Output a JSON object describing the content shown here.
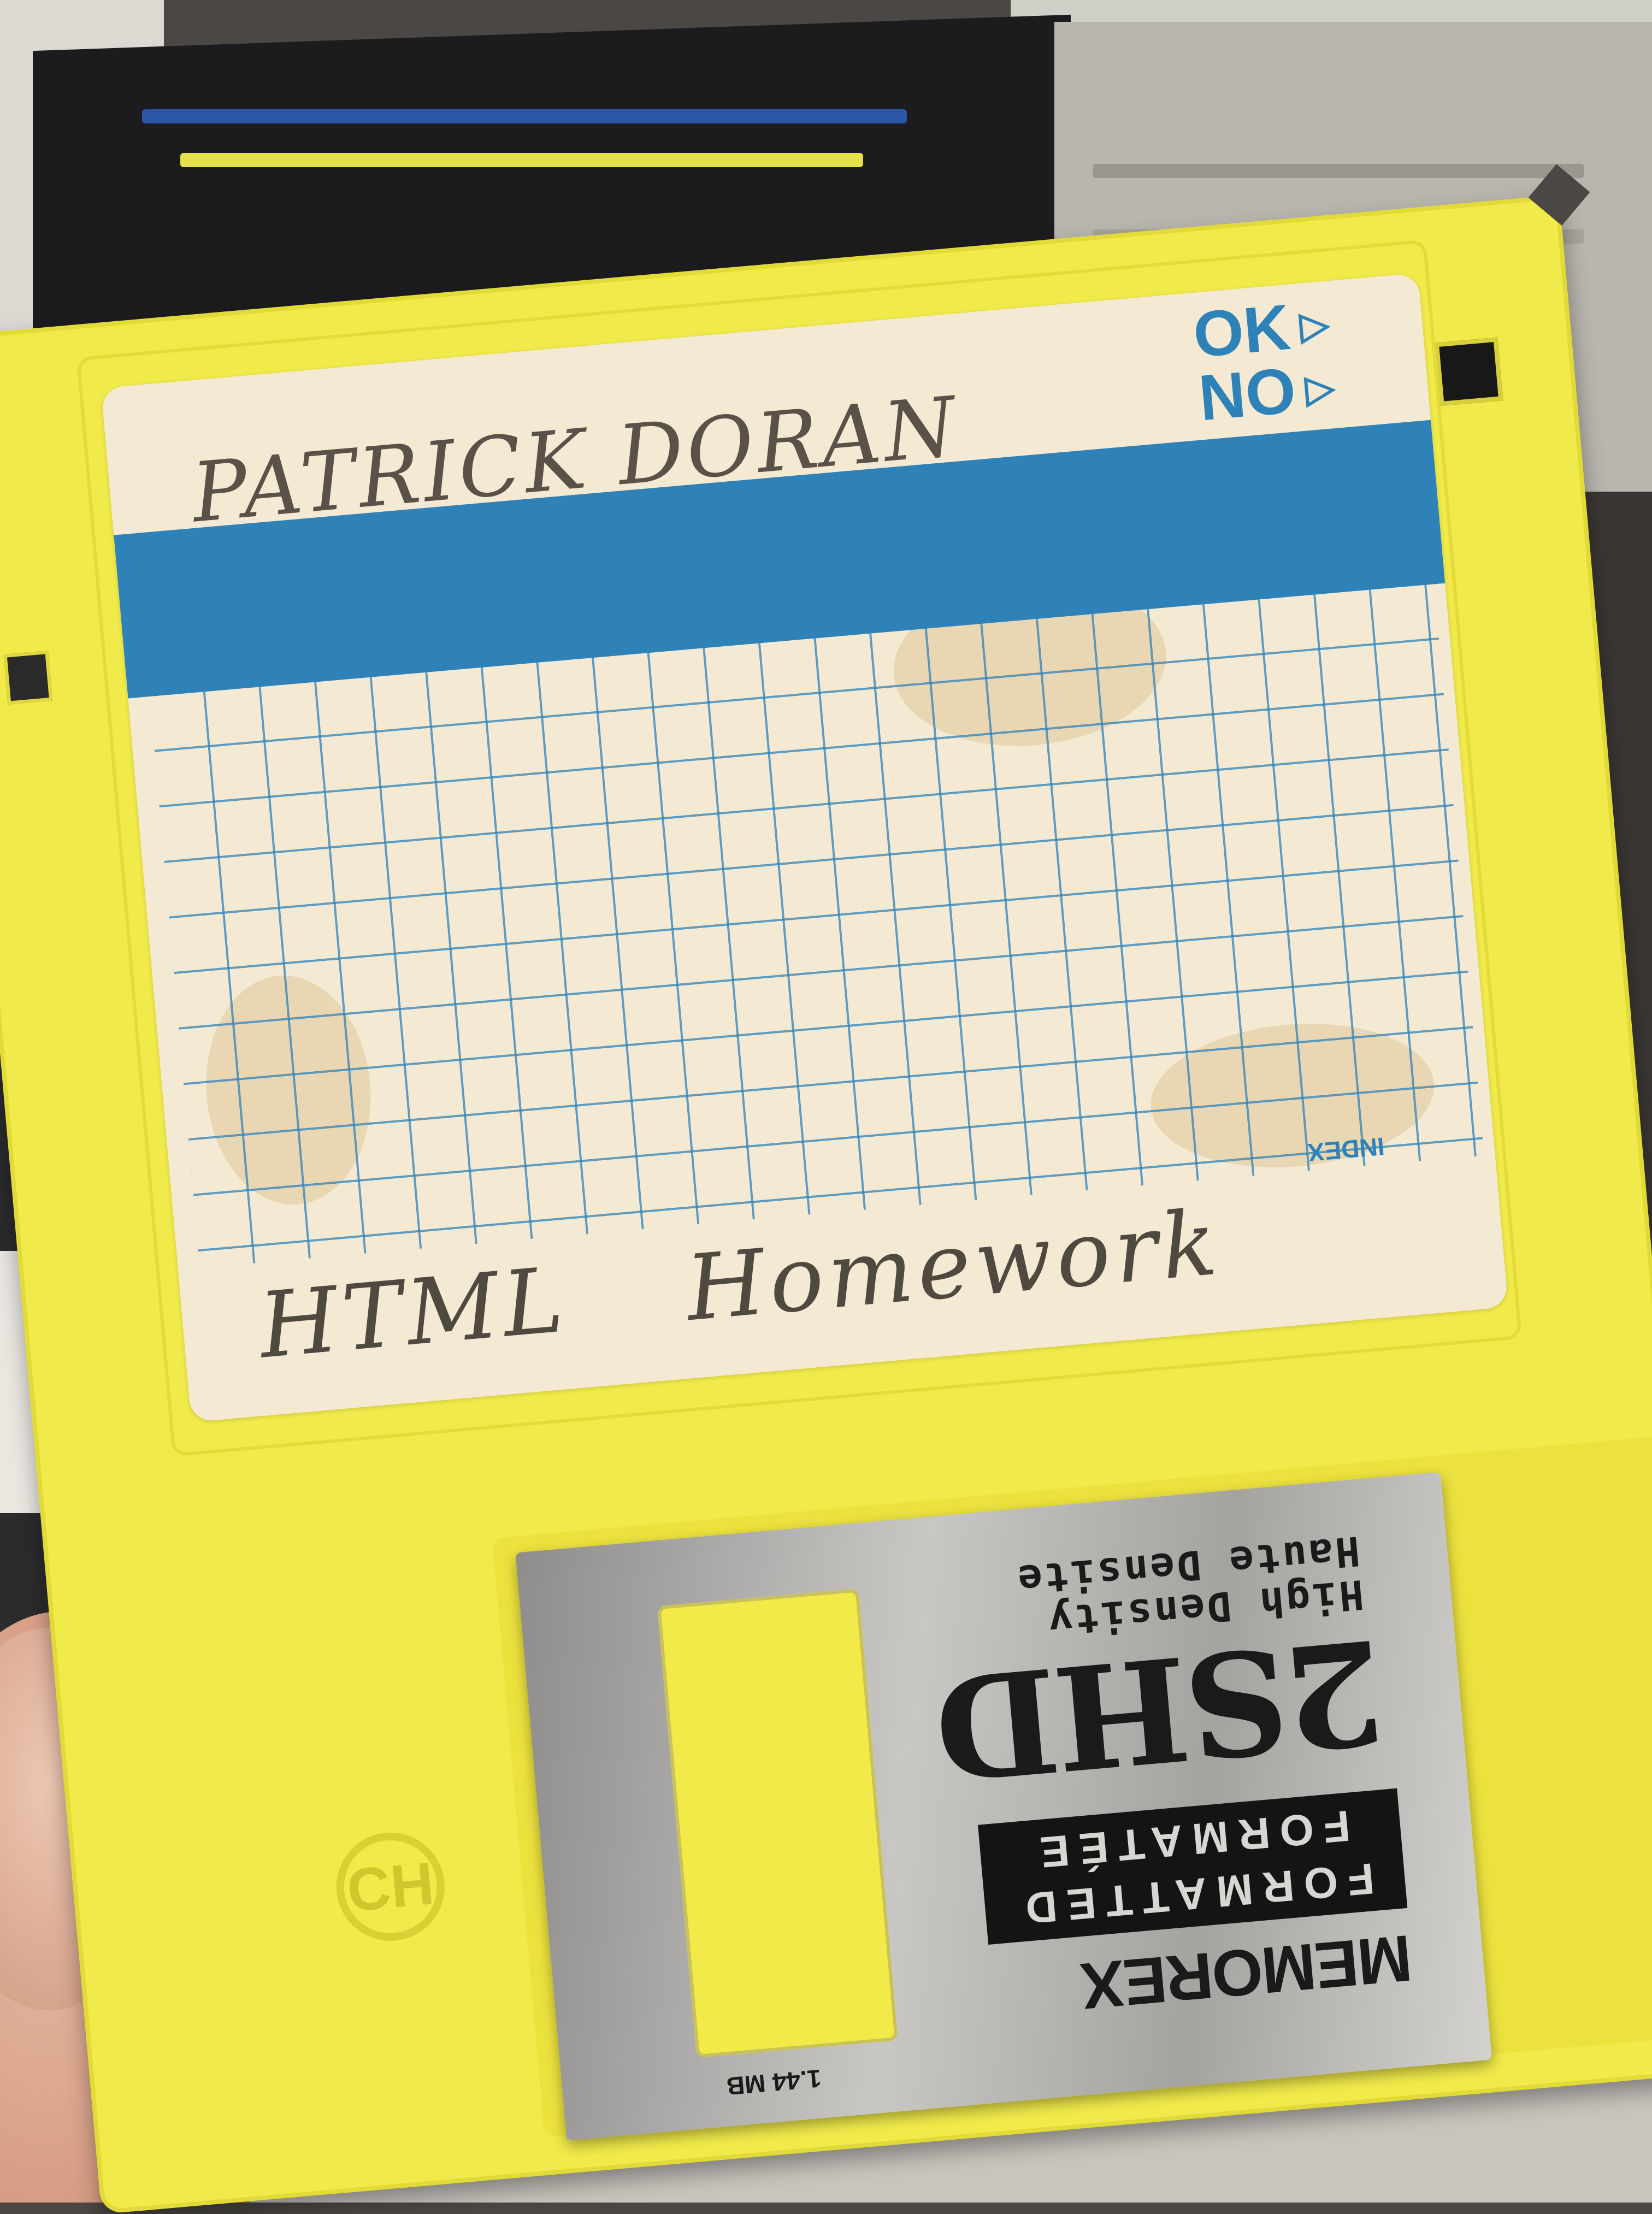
{
  "label": {
    "owner": "PATRICK DORAN",
    "contents": [
      "HTML",
      "Homework"
    ],
    "ok_text": "OK",
    "no_text": "NO",
    "index_text": "INDEX"
  },
  "shutter": {
    "brand": "MEMOREX",
    "formatted_line1": "FORMATTED",
    "formatted_line2": "FORMATÉE",
    "model": "2SHD",
    "density_en": "High Density",
    "density_fr": "Haute Densite",
    "capacity": "1.44 MB"
  },
  "logo_mark": "CH",
  "colors": {
    "disk_yellow": "#f0ea4a",
    "label_blue": "#2f82b8",
    "label_paper": "#f4ead4",
    "shutter_metal": "#b5b3b0"
  }
}
